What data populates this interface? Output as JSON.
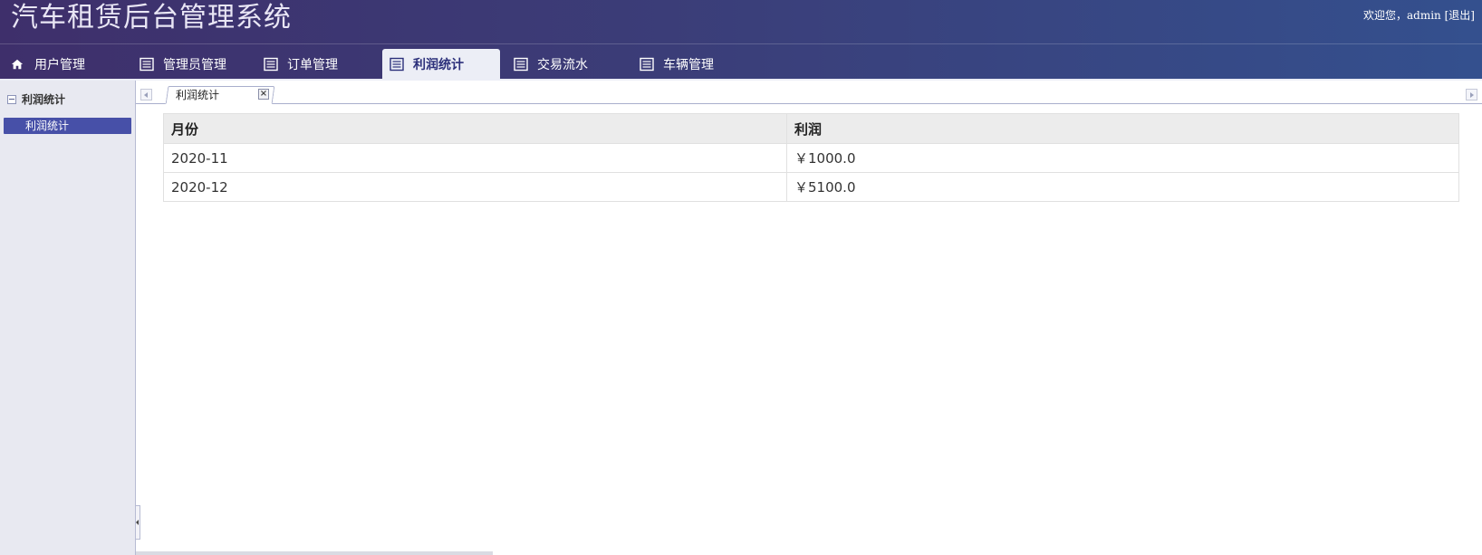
{
  "header": {
    "title": "汽车租赁后台管理系统",
    "welcome": "欢迎您，admin",
    "logout": "[退出]"
  },
  "nav": {
    "items": [
      {
        "label": "用户管理",
        "icon": "home-icon"
      },
      {
        "label": "管理员管理",
        "icon": "list-icon"
      },
      {
        "label": "订单管理",
        "icon": "list-icon"
      },
      {
        "label": "利润统计",
        "icon": "list-icon",
        "active": true
      },
      {
        "label": "交易流水",
        "icon": "list-icon"
      },
      {
        "label": "车辆管理",
        "icon": "list-icon"
      }
    ]
  },
  "sidebar": {
    "group": "利润统计",
    "items": [
      {
        "label": "利润统计",
        "selected": true
      }
    ]
  },
  "tabs": [
    {
      "label": "利润统计"
    }
  ],
  "table": {
    "columns": [
      "月份",
      "利润"
    ],
    "rows": [
      [
        "2020-11",
        "￥1000.0"
      ],
      [
        "2020-12",
        "￥5100.0"
      ]
    ]
  },
  "colors": {
    "header_start": "#3e2f6b",
    "header_end": "#34508e",
    "sidebar_bg": "#e8e9f1",
    "sidebar_selected": "#4750a8",
    "active_tab_text": "#2b2f7a"
  }
}
